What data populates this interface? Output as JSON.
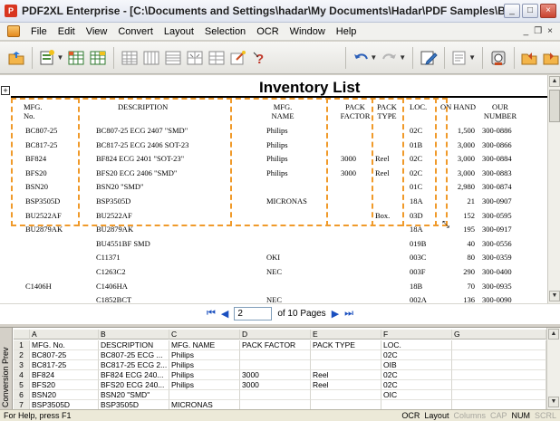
{
  "window": {
    "title": "PDF2XL Enterprise - [C:\\Documents and Settings\\hadar\\My Documents\\Hadar\\PDF Samples\\Bank statement\\inv...",
    "app_icon_letter": "P",
    "minimize": "_",
    "maximize": "□",
    "close": "×"
  },
  "menu": {
    "items": [
      "File",
      "Edit",
      "View",
      "Convert",
      "Layout",
      "Selection",
      "OCR",
      "Window",
      "Help"
    ],
    "mdi_minimize": "_",
    "mdi_restore": "❐",
    "mdi_close": "×"
  },
  "toolbar": {
    "icons": [
      "open-folder-icon",
      "new-layout-icon",
      "excel-export-icon",
      "table-icon",
      "grid-icon",
      "columns-icon",
      "rows-icon",
      "merge-icon",
      "split-icon",
      "wizard-icon",
      "help-icon",
      "undo-icon",
      "redo-icon",
      "edit-icon",
      "properties-icon",
      "ocr-icon",
      "back-icon",
      "forward-icon"
    ]
  },
  "document": {
    "title": "Inventory List",
    "headers": {
      "mfg_no": "MFG.\nNo.",
      "description": "DESCRIPTION",
      "mfg_name": "MFG.\nNAME",
      "pack_factor": "PACK\nFACTOR",
      "pack_type": "PACK\nTYPE",
      "loc": "LOC.",
      "on_hand": "ON HAND",
      "our_number": "OUR\nNUMBER"
    },
    "rows": [
      {
        "mfg_no": "BC807-25",
        "description": "BC807-25 ECG 2407  \"SMD\"",
        "mfg_name": "Philips",
        "pack_factor": "",
        "pack_type": "",
        "loc": "02C",
        "on_hand": "1,500",
        "our_number": "300-0886"
      },
      {
        "mfg_no": "BC817-25",
        "description": "BC817-25  ECG 2406  SOT-23",
        "mfg_name": "Philips",
        "pack_factor": "",
        "pack_type": "",
        "loc": "01B",
        "on_hand": "3,000",
        "our_number": "300-0866"
      },
      {
        "mfg_no": "BF824",
        "description": "BF824 ECG 2401  \"SOT-23\"",
        "mfg_name": "Philips",
        "pack_factor": "3000",
        "pack_type": "Reel",
        "loc": "02C",
        "on_hand": "3,000",
        "our_number": "300-0884"
      },
      {
        "mfg_no": "BFS20",
        "description": "BFS20 ECG 2406  \"SMD\"",
        "mfg_name": "Philips",
        "pack_factor": "3000",
        "pack_type": "Reel",
        "loc": "02C",
        "on_hand": "3,000",
        "our_number": "300-0883"
      },
      {
        "mfg_no": "BSN20",
        "description": "BSN20  \"SMD\"",
        "mfg_name": "",
        "pack_factor": "",
        "pack_type": "",
        "loc": "01C",
        "on_hand": "2,980",
        "our_number": "300-0874"
      },
      {
        "mfg_no": "BSP3505D",
        "description": "BSP3505D",
        "mfg_name": "MICRONAS",
        "pack_factor": "",
        "pack_type": "",
        "loc": "18A",
        "on_hand": "21",
        "our_number": "300-0907"
      },
      {
        "mfg_no": "BU2522AF",
        "description": "BU2522AF",
        "mfg_name": "",
        "pack_factor": "",
        "pack_type": "Box.",
        "loc": "03D",
        "on_hand": "152",
        "our_number": "300-0595"
      },
      {
        "mfg_no": "BU2879AK",
        "description": "BU2879AK",
        "mfg_name": "",
        "pack_factor": "",
        "pack_type": "",
        "loc": "18A",
        "on_hand": "195",
        "our_number": "300-0917"
      },
      {
        "mfg_no": "",
        "description": "BU4551BF SMD",
        "mfg_name": "",
        "pack_factor": "",
        "pack_type": "",
        "loc": "019B",
        "on_hand": "40",
        "our_number": "300-0556"
      },
      {
        "mfg_no": "",
        "description": "C11371",
        "mfg_name": "OKI",
        "pack_factor": "",
        "pack_type": "",
        "loc": "003C",
        "on_hand": "80",
        "our_number": "300-0359"
      },
      {
        "mfg_no": "",
        "description": "C1263C2",
        "mfg_name": "NEC",
        "pack_factor": "",
        "pack_type": "",
        "loc": "003F",
        "on_hand": "290",
        "our_number": "300-0400"
      },
      {
        "mfg_no": "C1406H",
        "description": "C1406HA",
        "mfg_name": "",
        "pack_factor": "",
        "pack_type": "",
        "loc": "18B",
        "on_hand": "70",
        "our_number": "300-0935"
      },
      {
        "mfg_no": "",
        "description": "C1852BCT",
        "mfg_name": "NEC",
        "pack_factor": "",
        "pack_type": "",
        "loc": "002A",
        "on_hand": "136",
        "our_number": "300-0090"
      }
    ]
  },
  "pager": {
    "first": "⏮",
    "prev": "◀",
    "page_value": "2",
    "of_pages": "of 10 Pages",
    "next": "▶",
    "last": "⏭"
  },
  "grid": {
    "side_tab_label": "Conversion Prev",
    "columns": [
      "",
      "A",
      "B",
      "C",
      "D",
      "E",
      "F",
      "G"
    ],
    "rows": [
      [
        "1",
        "MFG. No.",
        "DESCRIPTION",
        "MFG. NAME",
        "PACK FACTOR",
        "PACK TYPE",
        "LOC.",
        ""
      ],
      [
        "2",
        "BC807-25",
        "BC807-25 ECG ...",
        "Philips",
        "",
        "",
        "02C",
        ""
      ],
      [
        "3",
        "BC817-25",
        "BC817-25 ECG 2...",
        "Philips",
        "",
        "",
        "OIB",
        ""
      ],
      [
        "4",
        "BF824",
        "BF824 ECG 240...",
        "Philips",
        "3000",
        "Reel",
        "02C",
        ""
      ],
      [
        "5",
        "BFS20",
        "BFS20 ECG 240...",
        "Philips",
        "3000",
        "Reel",
        "02C",
        ""
      ],
      [
        "6",
        "BSN20",
        "BSN20 \"SMD\"",
        "",
        "",
        "",
        "OIC",
        ""
      ],
      [
        "7",
        "BSP3505D",
        "BSP3505D",
        "MICRONAS",
        "",
        "",
        "",
        ""
      ]
    ]
  },
  "status": {
    "left": "For Help, press F1",
    "ocr": "OCR",
    "layout": "Layout",
    "columns": "Columns",
    "cap": "CAP",
    "num": "NUM",
    "scrl": "SCRL"
  }
}
